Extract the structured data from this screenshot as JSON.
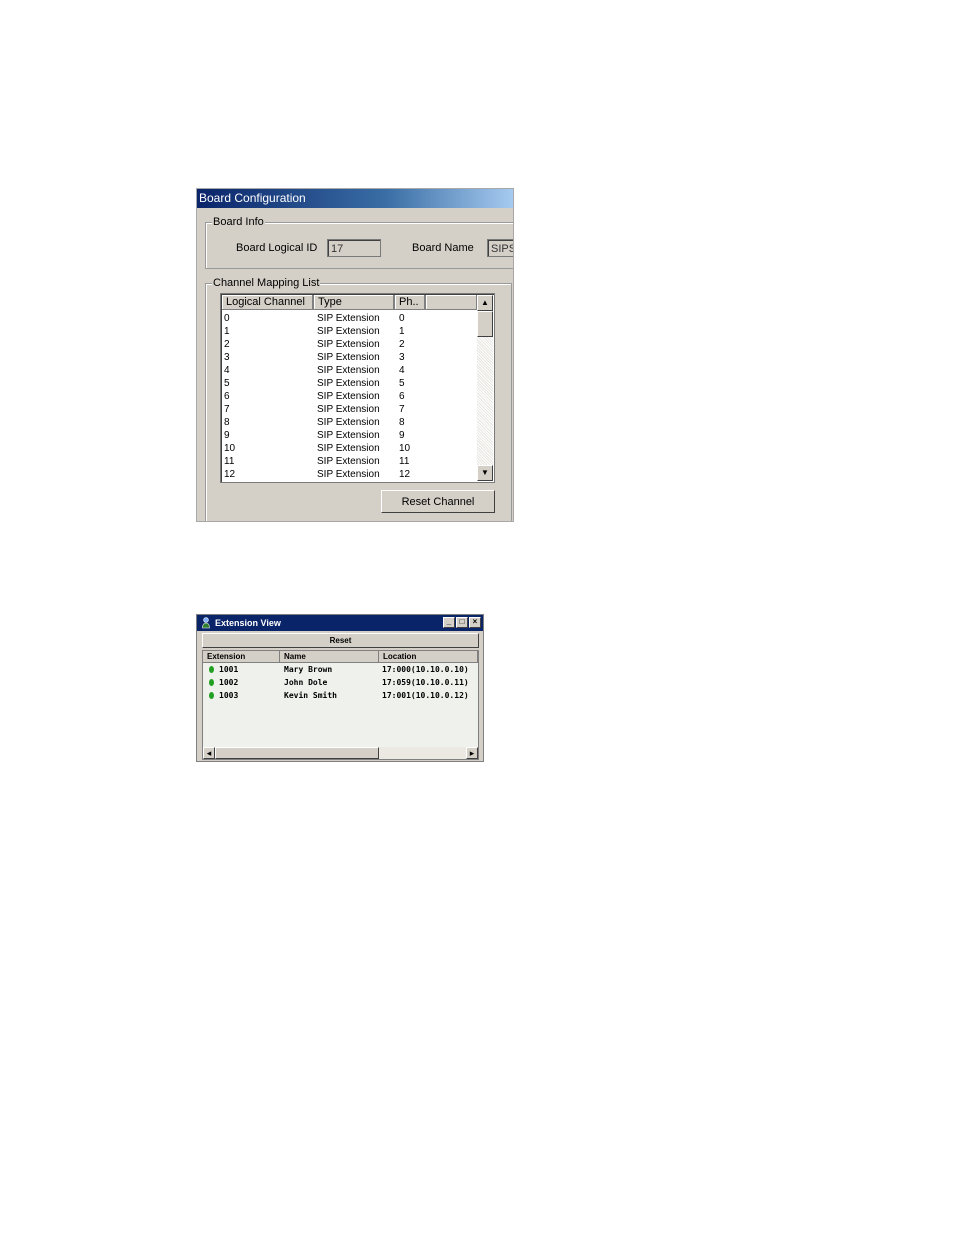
{
  "board_config": {
    "title": "Board Configuration",
    "board_info": {
      "legend": "Board Info",
      "logical_id_label": "Board Logical ID",
      "logical_id_value": "17",
      "board_name_label": "Board Name",
      "board_name_value": "SIPSI"
    },
    "channel_mapping": {
      "legend": "Channel Mapping List",
      "columns": [
        "Logical Channel",
        "Type",
        "Ph.."
      ],
      "rows": [
        {
          "logical": "0",
          "type": "SIP Extension",
          "ph": "0"
        },
        {
          "logical": "1",
          "type": "SIP Extension",
          "ph": "1"
        },
        {
          "logical": "2",
          "type": "SIP Extension",
          "ph": "2"
        },
        {
          "logical": "3",
          "type": "SIP Extension",
          "ph": "3"
        },
        {
          "logical": "4",
          "type": "SIP Extension",
          "ph": "4"
        },
        {
          "logical": "5",
          "type": "SIP Extension",
          "ph": "5"
        },
        {
          "logical": "6",
          "type": "SIP Extension",
          "ph": "6"
        },
        {
          "logical": "7",
          "type": "SIP Extension",
          "ph": "7"
        },
        {
          "logical": "8",
          "type": "SIP Extension",
          "ph": "8"
        },
        {
          "logical": "9",
          "type": "SIP Extension",
          "ph": "9"
        },
        {
          "logical": "10",
          "type": "SIP Extension",
          "ph": "10"
        },
        {
          "logical": "11",
          "type": "SIP Extension",
          "ph": "11"
        },
        {
          "logical": "12",
          "type": "SIP Extension",
          "ph": "12"
        }
      ]
    },
    "reset_channel_label": "Reset Channel",
    "scroll_up_glyph": "▲",
    "scroll_down_glyph": "▼"
  },
  "extension_view": {
    "title": "Extension View",
    "app_icon": "phone-person-icon",
    "window_buttons": {
      "minimize": "_",
      "maximize": "□",
      "close": "×"
    },
    "reset_label": "Reset",
    "columns": [
      "Extension",
      "Name",
      "Location"
    ],
    "rows": [
      {
        "extension": "1001",
        "name": "Mary Brown",
        "location": "17:000(10.10.0.10)",
        "status_color": "#22a022"
      },
      {
        "extension": "1002",
        "name": "John  Dole",
        "location": "17:059(10.10.0.11)",
        "status_color": "#22a022"
      },
      {
        "extension": "1003",
        "name": "Kevin Smith",
        "location": "17:001(10.10.0.12)",
        "status_color": "#22a022"
      }
    ],
    "scroll_left_glyph": "◂",
    "scroll_right_glyph": "▸"
  }
}
